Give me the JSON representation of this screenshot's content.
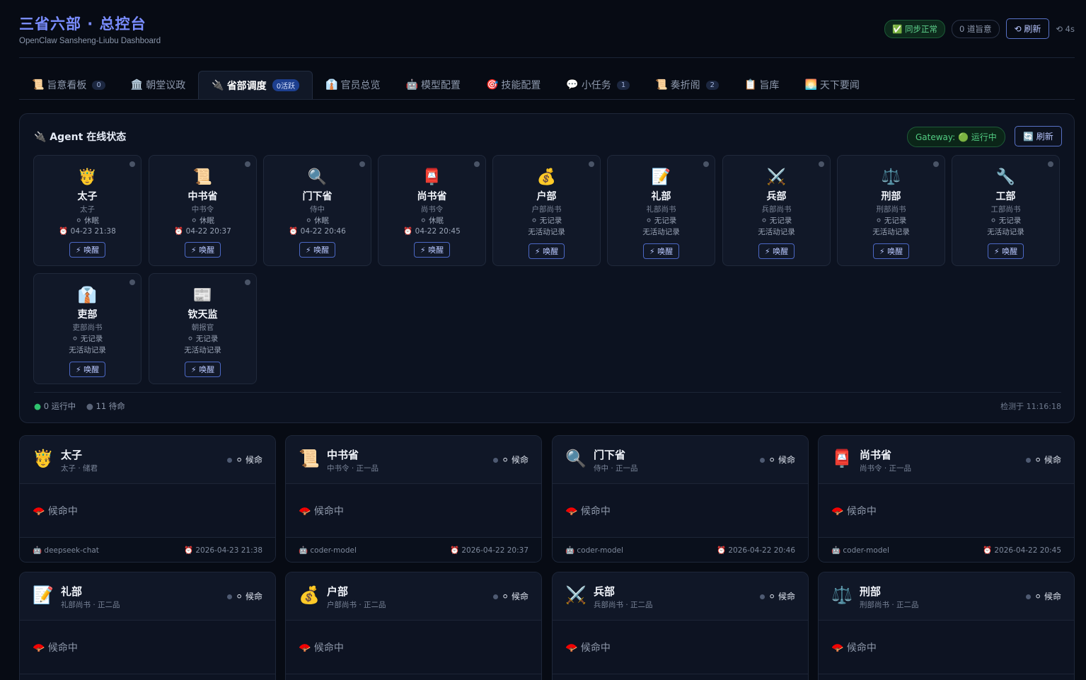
{
  "header": {
    "title": "三省六部 · 总控台",
    "subtitle": "OpenClaw Sansheng-Liubu Dashboard",
    "sync": "✅ 同步正常",
    "edicts": "0 道旨意",
    "refresh": "⟲ 刷新",
    "timer": "⟲ 4s"
  },
  "tabs": [
    {
      "icon": "📜",
      "label": "旨意看板",
      "badge": "0"
    },
    {
      "icon": "🏛️",
      "label": "朝堂议政",
      "badge": ""
    },
    {
      "icon": "🔌",
      "label": "省部调度",
      "badge": "0活跃"
    },
    {
      "icon": "👔",
      "label": "官员总览",
      "badge": ""
    },
    {
      "icon": "🤖",
      "label": "模型配置",
      "badge": ""
    },
    {
      "icon": "🎯",
      "label": "技能配置",
      "badge": ""
    },
    {
      "icon": "💬",
      "label": "小任务",
      "badge": "1"
    },
    {
      "icon": "📜",
      "label": "奏折阁",
      "badge": "2"
    },
    {
      "icon": "📋",
      "label": "旨库",
      "badge": ""
    },
    {
      "icon": "🌅",
      "label": "天下要闻",
      "badge": ""
    }
  ],
  "panel": {
    "title": "🔌 Agent 在线状态",
    "gateway": "Gateway: 🟢 运行中",
    "refresh": "🔄 刷新",
    "running": "0 运行中",
    "waiting": "11 待命",
    "checked": "检测于 11:16:18"
  },
  "agents": [
    {
      "emoji": "🤴",
      "name": "太子",
      "role": "太子",
      "state": "⚪ 休眠",
      "time": "⏰ 04-23 21:38",
      "wake": "⚡ 唤醒"
    },
    {
      "emoji": "📜",
      "name": "中书省",
      "role": "中书令",
      "state": "⚪ 休眠",
      "time": "⏰ 04-22 20:37",
      "wake": "⚡ 唤醒"
    },
    {
      "emoji": "🔍",
      "name": "门下省",
      "role": "侍中",
      "state": "⚪ 休眠",
      "time": "⏰ 04-22 20:46",
      "wake": "⚡ 唤醒"
    },
    {
      "emoji": "📮",
      "name": "尚书省",
      "role": "尚书令",
      "state": "⚪ 休眠",
      "time": "⏰ 04-22 20:45",
      "wake": "⚡ 唤醒"
    },
    {
      "emoji": "💰",
      "name": "户部",
      "role": "户部尚书",
      "state": "⚪ 无记录",
      "time": "无活动记录",
      "wake": "⚡ 唤醒"
    },
    {
      "emoji": "📝",
      "name": "礼部",
      "role": "礼部尚书",
      "state": "⚪ 无记录",
      "time": "无活动记录",
      "wake": "⚡ 唤醒"
    },
    {
      "emoji": "⚔️",
      "name": "兵部",
      "role": "兵部尚书",
      "state": "⚪ 无记录",
      "time": "无活动记录",
      "wake": "⚡ 唤醒"
    },
    {
      "emoji": "⚖️",
      "name": "刑部",
      "role": "刑部尚书",
      "state": "⚪ 无记录",
      "time": "无活动记录",
      "wake": "⚡ 唤醒"
    },
    {
      "emoji": "🔧",
      "name": "工部",
      "role": "工部尚书",
      "state": "⚪ 无记录",
      "time": "无活动记录",
      "wake": "⚡ 唤醒"
    },
    {
      "emoji": "👔",
      "name": "吏部",
      "role": "吏部尚书",
      "state": "⚪ 无记录",
      "time": "无活动记录",
      "wake": "⚡ 唤醒"
    },
    {
      "emoji": "📰",
      "name": "钦天监",
      "role": "朝报官",
      "state": "⚪ 无记录",
      "time": "无活动记录",
      "wake": "⚡ 唤醒"
    }
  ],
  "depts": [
    {
      "emoji": "🤴",
      "name": "太子",
      "rank": "太子 · 储君",
      "status": "⚪ 候命",
      "body": "🪭 候命中",
      "model": "🤖 deepseek-chat",
      "time": "⏰ 2026-04-23 21:38"
    },
    {
      "emoji": "📜",
      "name": "中书省",
      "rank": "中书令 · 正一品",
      "status": "⚪ 候命",
      "body": "🪭 候命中",
      "model": "🤖 coder-model",
      "time": "⏰ 2026-04-22 20:37"
    },
    {
      "emoji": "🔍",
      "name": "门下省",
      "rank": "侍中 · 正一品",
      "status": "⚪ 候命",
      "body": "🪭 候命中",
      "model": "🤖 coder-model",
      "time": "⏰ 2026-04-22 20:46"
    },
    {
      "emoji": "📮",
      "name": "尚书省",
      "rank": "尚书令 · 正一品",
      "status": "⚪ 候命",
      "body": "🪭 候命中",
      "model": "🤖 coder-model",
      "time": "⏰ 2026-04-22 20:45"
    },
    {
      "emoji": "📝",
      "name": "礼部",
      "rank": "礼部尚书 · 正二品",
      "status": "⚪ 候命",
      "body": "🪭 候命中",
      "model": "",
      "time": ""
    },
    {
      "emoji": "💰",
      "name": "户部",
      "rank": "户部尚书 · 正二品",
      "status": "⚪ 候命",
      "body": "🪭 候命中",
      "model": "",
      "time": ""
    },
    {
      "emoji": "⚔️",
      "name": "兵部",
      "rank": "兵部尚书 · 正二品",
      "status": "⚪ 候命",
      "body": "🪭 候命中",
      "model": "",
      "time": ""
    },
    {
      "emoji": "⚖️",
      "name": "刑部",
      "rank": "刑部尚书 · 正二品",
      "status": "⚪ 候命",
      "body": "🪭 候命中",
      "model": "",
      "time": ""
    }
  ]
}
